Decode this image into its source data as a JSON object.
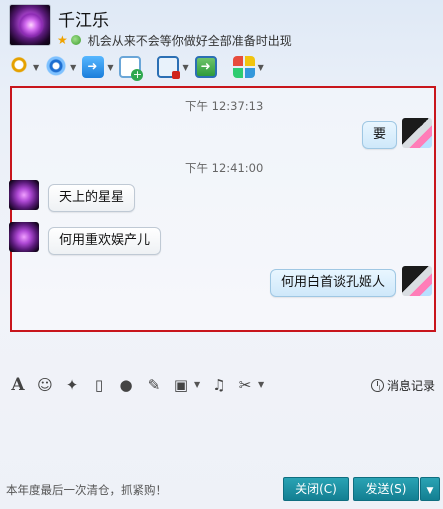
{
  "contact": {
    "name": "千江乐",
    "signature": "机会从来不会等你做好全部准备时出现"
  },
  "toolbar": {
    "items": [
      {
        "icon": "microphone-icon"
      },
      {
        "icon": "video-camera-icon"
      },
      {
        "icon": "file-transfer-icon"
      },
      {
        "icon": "add-app-icon"
      },
      {
        "icon": "remote-screen-icon"
      },
      {
        "icon": "screen-share-icon"
      },
      {
        "icon": "apps-grid-icon"
      }
    ]
  },
  "chat": {
    "times": [
      "下午 12:37:13",
      "下午 12:41:00"
    ],
    "messages": [
      {
        "sender": "me",
        "text": "要"
      },
      {
        "sender": "contact",
        "text": "天上的星星"
      },
      {
        "sender": "contact",
        "text": "何用重欢娱产儿"
      },
      {
        "sender": "me",
        "text": "何用白首谈孔姬人"
      }
    ]
  },
  "input_toolbar": {
    "icons": [
      "font-icon",
      "emoji-icon",
      "magic-icon",
      "shake-icon",
      "voice-icon",
      "edit-icon",
      "image-icon",
      "music-icon",
      "scissors-icon"
    ],
    "history_label": "消息记录"
  },
  "footer": {
    "tip": "本年度最后一次清仓，抓紧购！",
    "close_label": "关闭(C)",
    "send_label": "发送(S)"
  },
  "colors": {
    "highlight_border": "#c8151c",
    "button": "#1a8ea0"
  }
}
